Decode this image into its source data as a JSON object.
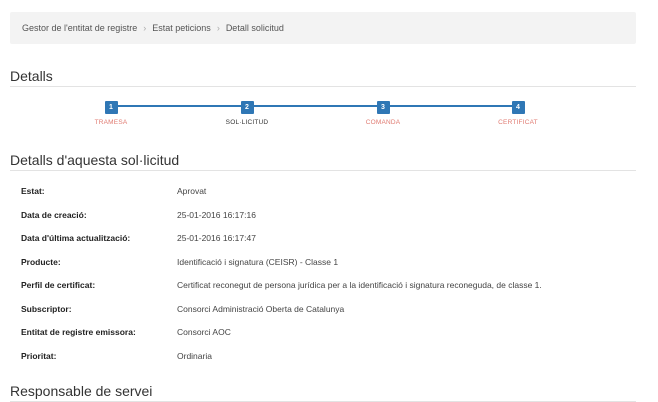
{
  "breadcrumb": {
    "items": [
      "Gestor de l'entitat de registre",
      "Estat peticions",
      "Detall solicitud"
    ],
    "separator": "›"
  },
  "sections": {
    "details_title": "Detalls",
    "request_title": "Detalls d'aquesta sol·licitud",
    "responsible_title": "Responsable de servei"
  },
  "steps": [
    {
      "number": "1",
      "label": "TRAMESA",
      "state": "done"
    },
    {
      "number": "2",
      "label": "SOL·LICITUD",
      "state": "active"
    },
    {
      "number": "3",
      "label": "COMANDA",
      "state": "pending"
    },
    {
      "number": "4",
      "label": "CERTIFICAT",
      "state": "pending"
    }
  ],
  "details": [
    {
      "key": "Estat:",
      "value": "Aprovat"
    },
    {
      "key": "Data de creació:",
      "value": "25-01-2016 16:17:16"
    },
    {
      "key": "Data d'última actualització:",
      "value": "25-01-2016 16:17:47"
    },
    {
      "key": "Producte:",
      "value": "Identificació i signatura (CEISR) - Classe 1"
    },
    {
      "key": "Perfil de certificat:",
      "value": "Certificat reconegut de persona jurídica per a la identificació i signatura reconeguda, de classe 1."
    },
    {
      "key": "Subscriptor:",
      "value": "Consorci Administració Oberta de Catalunya"
    },
    {
      "key": "Entitat de registre emissora:",
      "value": "Consorci AOC"
    },
    {
      "key": "Prioritat:",
      "value": "Ordinaria"
    }
  ],
  "colors": {
    "accent": "#2f77b5",
    "step_done_label": "#e07b72",
    "breadcrumb_bg": "#f3f3f3"
  }
}
